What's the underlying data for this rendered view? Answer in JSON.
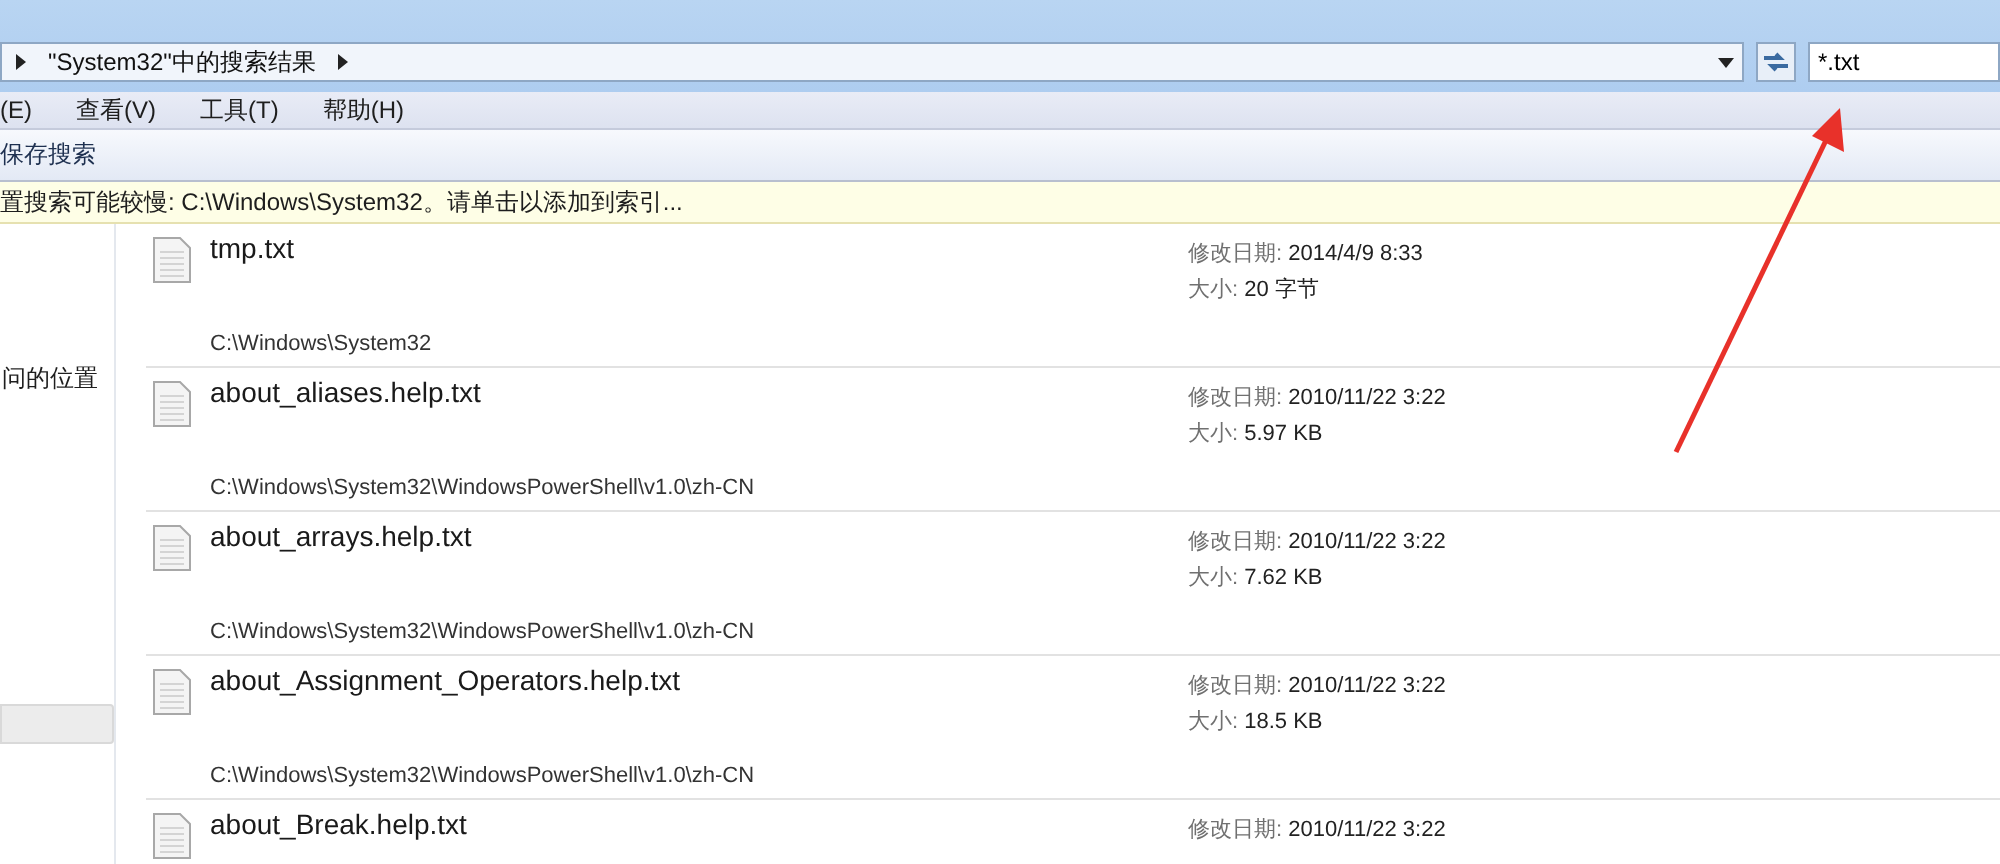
{
  "address_bar": {
    "breadcrumb": "\"System32\"中的搜索结果"
  },
  "search": {
    "value": "*.txt"
  },
  "menu": [
    "(E)",
    "查看(V)",
    "工具(T)",
    "帮助(H)"
  ],
  "toolbar": {
    "buttons": [
      "保存搜索"
    ]
  },
  "info_bar": {
    "text": "置搜索可能较慢: C:\\Windows\\System32。请单击以添加到索引..."
  },
  "sidebar": {
    "items": [
      {
        "label": "问的位置",
        "selected": false
      },
      {
        "selected": true
      }
    ]
  },
  "results": [
    {
      "name": "tmp.txt",
      "path": "C:\\Windows\\System32",
      "date_label": "修改日期:",
      "date": "2014/4/9 8:33",
      "size_label": "大小:",
      "size": "20 字节"
    },
    {
      "name": "about_aliases.help.txt",
      "path": "C:\\Windows\\System32\\WindowsPowerShell\\v1.0\\zh-CN",
      "date_label": "修改日期:",
      "date": "2010/11/22 3:22",
      "size_label": "大小:",
      "size": "5.97 KB"
    },
    {
      "name": "about_arrays.help.txt",
      "path": "C:\\Windows\\System32\\WindowsPowerShell\\v1.0\\zh-CN",
      "date_label": "修改日期:",
      "date": "2010/11/22 3:22",
      "size_label": "大小:",
      "size": "7.62 KB"
    },
    {
      "name": "about_Assignment_Operators.help.txt",
      "path": "C:\\Windows\\System32\\WindowsPowerShell\\v1.0\\zh-CN",
      "date_label": "修改日期:",
      "date": "2010/11/22 3:22",
      "size_label": "大小:",
      "size": "18.5 KB"
    },
    {
      "name": "about_Break.help.txt",
      "date_label": "修改日期:",
      "date": "2010/11/22 3:22"
    }
  ]
}
